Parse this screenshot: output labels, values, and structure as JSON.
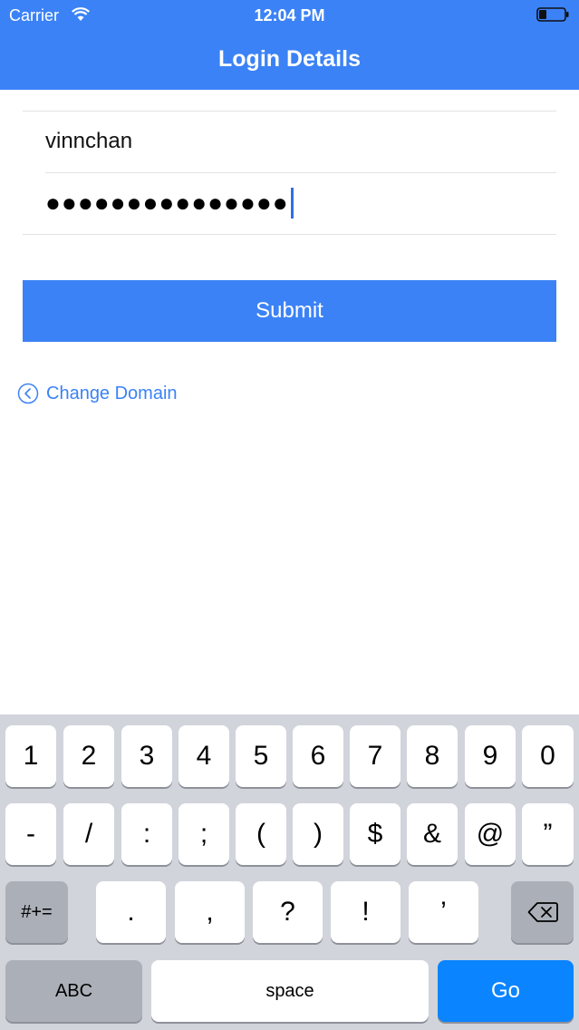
{
  "status_bar": {
    "carrier": "Carrier",
    "time": "12:04 PM"
  },
  "header": {
    "title": "Login Details"
  },
  "form": {
    "username_value": "vinnchan",
    "password_masked": "●●●●●●●●●●●●●●●",
    "submit_label": "Submit",
    "change_domain_label": "Change Domain"
  },
  "keyboard": {
    "row1": [
      "1",
      "2",
      "3",
      "4",
      "5",
      "6",
      "7",
      "8",
      "9",
      "0"
    ],
    "row2": [
      "-",
      "/",
      ":",
      ";",
      "(",
      ")",
      "$",
      "&",
      "@",
      "”"
    ],
    "row3_symbols_toggle": "#+=",
    "row3": [
      ".",
      ",",
      "?",
      "!",
      "’"
    ],
    "abc_label": "ABC",
    "space_label": "space",
    "go_label": "Go"
  },
  "colors": {
    "accent": "#3b82f6",
    "go_key": "#0a84ff",
    "keyboard_bg": "#d1d4db"
  },
  "icons": [
    "wifi-icon",
    "battery-icon",
    "chevron-left-circle-icon",
    "backspace-icon"
  ]
}
